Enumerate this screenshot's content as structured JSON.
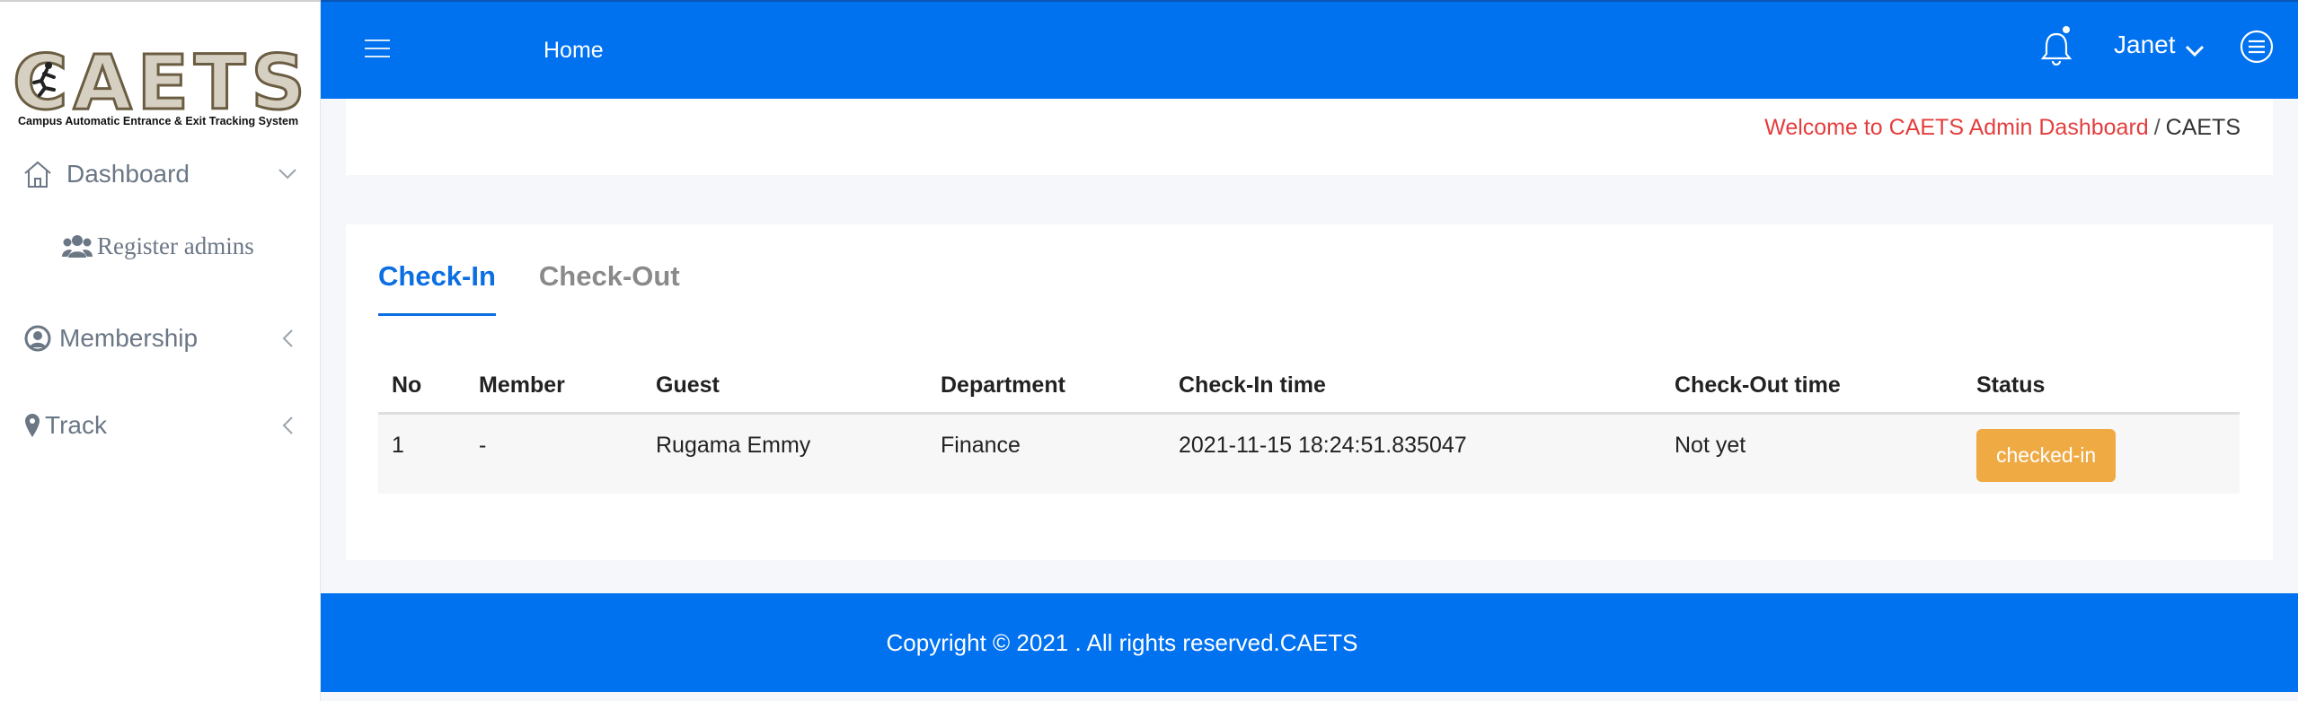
{
  "brand": {
    "logo_text": "CAETS",
    "logo_subtitle": "Campus Automatic Entrance & Exit Tracking System"
  },
  "sidebar": {
    "items": [
      {
        "label": "Dashboard",
        "icon": "home-icon",
        "chevron": "down"
      },
      {
        "label": "Register admins",
        "icon": "users-icon"
      },
      {
        "label": "Membership",
        "icon": "user-circle-icon",
        "chevron": "left"
      },
      {
        "label": "Track",
        "icon": "map-marker-icon",
        "chevron": "left"
      }
    ]
  },
  "topbar": {
    "menu_icon": "hamburger-icon",
    "home_label": "Home",
    "notification_icon": "bell-icon",
    "user_name": "Janet",
    "settings_icon": "menu-circle-icon"
  },
  "breadcrumb": {
    "link": "Welcome to CAETS Admin Dashboard",
    "separator": "/",
    "current": "CAETS"
  },
  "tabs": [
    {
      "label": "Check-In",
      "active": true
    },
    {
      "label": "Check-Out",
      "active": false
    }
  ],
  "table": {
    "columns": [
      "No",
      "Member",
      "Guest",
      "Department",
      "Check-In time",
      "Check-Out time",
      "Status"
    ],
    "rows": [
      {
        "no": "1",
        "member": "-",
        "guest": "Rugama Emmy",
        "department": "Finance",
        "checkin": "2021-11-15 18:24:51.835047",
        "checkout": "Not yet",
        "status": "checked-in"
      }
    ]
  },
  "footer": {
    "text": "Copyright © 2021 . All rights reserved.CAETS"
  },
  "colors": {
    "primary": "#0071ef",
    "tab_active": "#0b6fe3",
    "breadcrumb_link": "#e43e3e",
    "status_badge": "#efaa44",
    "sidebar_text": "#6b7785"
  }
}
